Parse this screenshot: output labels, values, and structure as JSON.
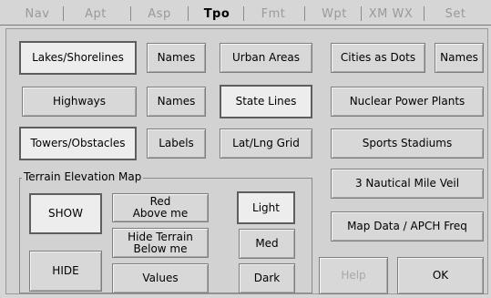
{
  "tabs": [
    "Nav",
    "Apt",
    "Asp",
    "Tpo",
    "Fmt",
    "Wpt",
    "XM WX",
    "Set"
  ],
  "active_tab": "Tpo",
  "buttons": {
    "lakes": "Lakes/Shorelines",
    "lakes_names": "Names",
    "urban": "Urban Areas",
    "cities": "Cities as Dots",
    "cities_names": "Names",
    "highways": "Highways",
    "highways_names": "Names",
    "state_lines": "State Lines",
    "nuclear": "Nuclear Power Plants",
    "towers": "Towers/Obstacles",
    "labels": "Labels",
    "latlng": "Lat/Lng Grid",
    "stadiums": "Sports Stadiums",
    "veil": "3 Nautical Mile Veil",
    "map_data": "Map Data / APCH Freq",
    "help": "Help",
    "ok": "OK"
  },
  "terrain": {
    "title": "Terrain Elevation Map",
    "show": "SHOW",
    "hide": "HIDE",
    "red_line1": "Red",
    "red_line2": "Above me",
    "hide_line1": "Hide Terrain",
    "hide_line2": "Below me",
    "values": "Values",
    "light": "Light",
    "med": "Med",
    "dark": "Dark"
  }
}
